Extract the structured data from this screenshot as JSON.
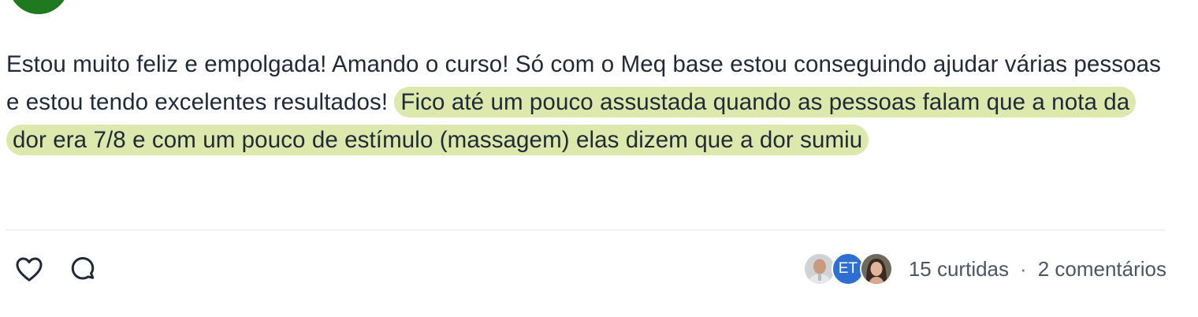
{
  "post": {
    "text_plain": "Estou muito feliz e empolgada! Amando o curso! Só com o Meq base estou conseguindo ajudar várias pessoas e estou tendo excelentes resultados! ",
    "text_highlighted": "Fico até um pouco assustada quando as pessoas falam que a nota da dor era 7/8 e com um pouco de estímulo (massagem) elas dizem que a dor sumiu",
    "highlight_color": "#dde8ad"
  },
  "actions": {
    "like_icon": "heart-icon",
    "comment_icon": "comment-bubble-icon"
  },
  "stats": {
    "avatars": [
      {
        "kind": "photo",
        "name": "bald-man"
      },
      {
        "kind": "initials",
        "initials": "ET",
        "color": "#2f6fd1"
      },
      {
        "kind": "photo",
        "name": "woman-dark-hair"
      }
    ],
    "likes": "15 curtidas",
    "separator": "·",
    "comments": "2 comentários"
  },
  "colors": {
    "text": "#1f2937",
    "muted": "#4b5563",
    "author_avatar": "#1f7a1f"
  }
}
